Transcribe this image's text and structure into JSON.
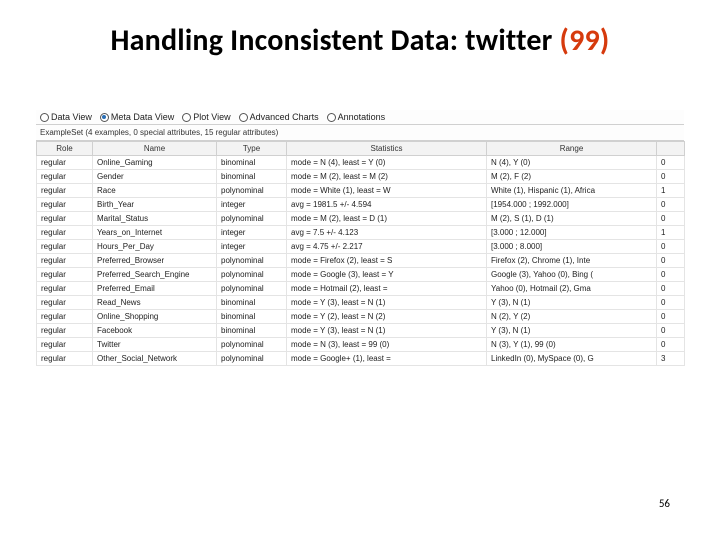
{
  "title_main": "Handling Inconsistent Data: twitter ",
  "title_accent": "(99)",
  "page_number": "56",
  "tabs": {
    "data": "Data View",
    "meta": "Meta Data View",
    "plot": "Plot View",
    "adv": "Advanced Charts",
    "ann": "Annotations"
  },
  "summary": "ExampleSet (4 examples, 0 special attributes, 15 regular attributes)",
  "headers": {
    "role": "Role",
    "name": "Name",
    "type": "Type",
    "stats": "Statistics",
    "range": "Range",
    "miss": ""
  },
  "rows": [
    {
      "role": "regular",
      "name": "Online_Gaming",
      "type": "binominal",
      "stats": "mode = N (4), least = Y (0)",
      "range": "N (4), Y (0)",
      "miss": "0"
    },
    {
      "role": "regular",
      "name": "Gender",
      "type": "binominal",
      "stats": "mode = M (2), least = M (2)",
      "range": "M (2), F (2)",
      "miss": "0"
    },
    {
      "role": "regular",
      "name": "Race",
      "type": "polynominal",
      "stats": "mode = White (1), least = W",
      "range": "White (1), Hispanic (1), Africa",
      "miss": "1"
    },
    {
      "role": "regular",
      "name": "Birth_Year",
      "type": "integer",
      "stats": "avg = 1981.5 +/- 4.594",
      "range": "[1954.000 ; 1992.000]",
      "miss": "0"
    },
    {
      "role": "regular",
      "name": "Marital_Status",
      "type": "polynominal",
      "stats": "mode = M (2), least = D (1)",
      "range": "M (2), S (1), D (1)",
      "miss": "0"
    },
    {
      "role": "regular",
      "name": "Years_on_Internet",
      "type": "integer",
      "stats": "avg = 7.5 +/- 4.123",
      "range": "[3.000 ; 12.000]",
      "miss": "1"
    },
    {
      "role": "regular",
      "name": "Hours_Per_Day",
      "type": "integer",
      "stats": "avg = 4.75 +/- 2.217",
      "range": "[3.000 ; 8.000]",
      "miss": "0"
    },
    {
      "role": "regular",
      "name": "Preferred_Browser",
      "type": "polynominal",
      "stats": "mode = Firefox (2), least = S",
      "range": "Firefox (2), Chrome (1), Inte",
      "miss": "0"
    },
    {
      "role": "regular",
      "name": "Preferred_Search_Engine",
      "type": "polynominal",
      "stats": "mode = Google (3), least = Y",
      "range": "Google (3), Yahoo (0), Bing (",
      "miss": "0"
    },
    {
      "role": "regular",
      "name": "Preferred_Email",
      "type": "polynominal",
      "stats": "mode = Hotmail (2), least =",
      "range": "Yahoo (0), Hotmail (2), Gma",
      "miss": "0"
    },
    {
      "role": "regular",
      "name": "Read_News",
      "type": "binominal",
      "stats": "mode = Y (3), least = N (1)",
      "range": "Y (3), N (1)",
      "miss": "0"
    },
    {
      "role": "regular",
      "name": "Online_Shopping",
      "type": "binominal",
      "stats": "mode = Y (2), least = N (2)",
      "range": "N (2), Y (2)",
      "miss": "0"
    },
    {
      "role": "regular",
      "name": "Facebook",
      "type": "binominal",
      "stats": "mode = Y (3), least = N (1)",
      "range": "Y (3), N (1)",
      "miss": "0"
    },
    {
      "role": "regular",
      "name": "Twitter",
      "type": "polynominal",
      "stats": "mode = N (3), least = 99 (0)",
      "range": "N (3), Y (1), 99 (0)",
      "miss": "0"
    },
    {
      "role": "regular",
      "name": "Other_Social_Network",
      "type": "polynominal",
      "stats": "mode = Google+ (1), least =",
      "range": "LinkedIn (0), MySpace (0), G",
      "miss": "3"
    }
  ]
}
